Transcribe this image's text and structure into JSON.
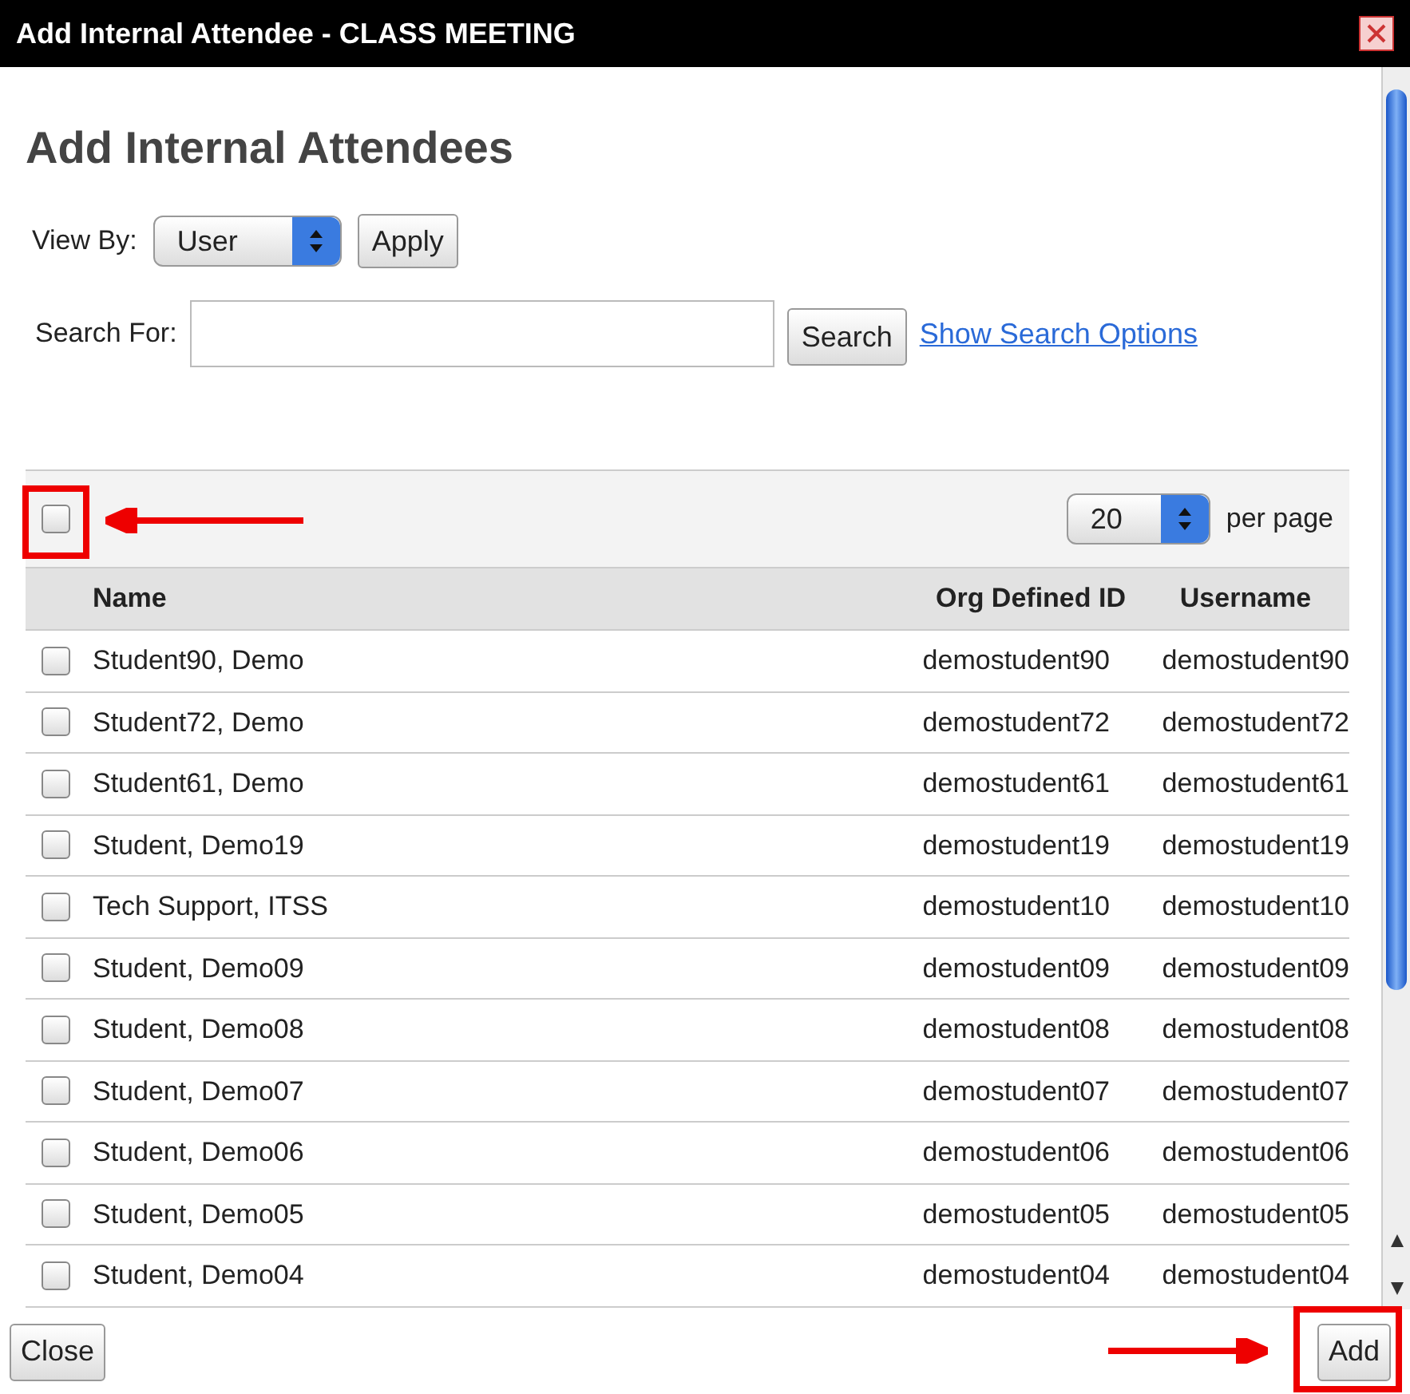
{
  "window": {
    "title": "Add Internal Attendee - CLASS MEETING"
  },
  "heading": "Add Internal Attendees",
  "view_by": {
    "label": "View By:",
    "value": "User",
    "apply_button": "Apply"
  },
  "search": {
    "label": "Search For:",
    "search_button": "Search",
    "options_link": "Show Search Options"
  },
  "table": {
    "select_all": {
      "checked": false
    },
    "per_page": {
      "value": "20",
      "label": "per page"
    },
    "columns": [
      "Name",
      "Org Defined ID",
      "Username"
    ],
    "rows": [
      {
        "checked": false,
        "name": "Student90, Demo",
        "org_id": "demostudent90",
        "username": "demostudent90"
      },
      {
        "checked": false,
        "name": "Student72, Demo",
        "org_id": "demostudent72",
        "username": "demostudent72"
      },
      {
        "checked": false,
        "name": "Student61, Demo",
        "org_id": "demostudent61",
        "username": "demostudent61"
      },
      {
        "checked": false,
        "name": "Student, Demo19",
        "org_id": "demostudent19",
        "username": "demostudent19"
      },
      {
        "checked": false,
        "name": "Tech Support, ITSS",
        "org_id": "demostudent10",
        "username": "demostudent10"
      },
      {
        "checked": false,
        "name": "Student, Demo09",
        "org_id": "demostudent09",
        "username": "demostudent09"
      },
      {
        "checked": false,
        "name": "Student, Demo08",
        "org_id": "demostudent08",
        "username": "demostudent08"
      },
      {
        "checked": false,
        "name": "Student, Demo07",
        "org_id": "demostudent07",
        "username": "demostudent07"
      },
      {
        "checked": false,
        "name": "Student, Demo06",
        "org_id": "demostudent06",
        "username": "demostudent06"
      },
      {
        "checked": false,
        "name": "Student, Demo05",
        "org_id": "demostudent05",
        "username": "demostudent05"
      },
      {
        "checked": false,
        "name": "Student, Demo04",
        "org_id": "demostudent04",
        "username": "demostudent04"
      }
    ]
  },
  "footer": {
    "close_button": "Close",
    "add_button": "Add"
  }
}
